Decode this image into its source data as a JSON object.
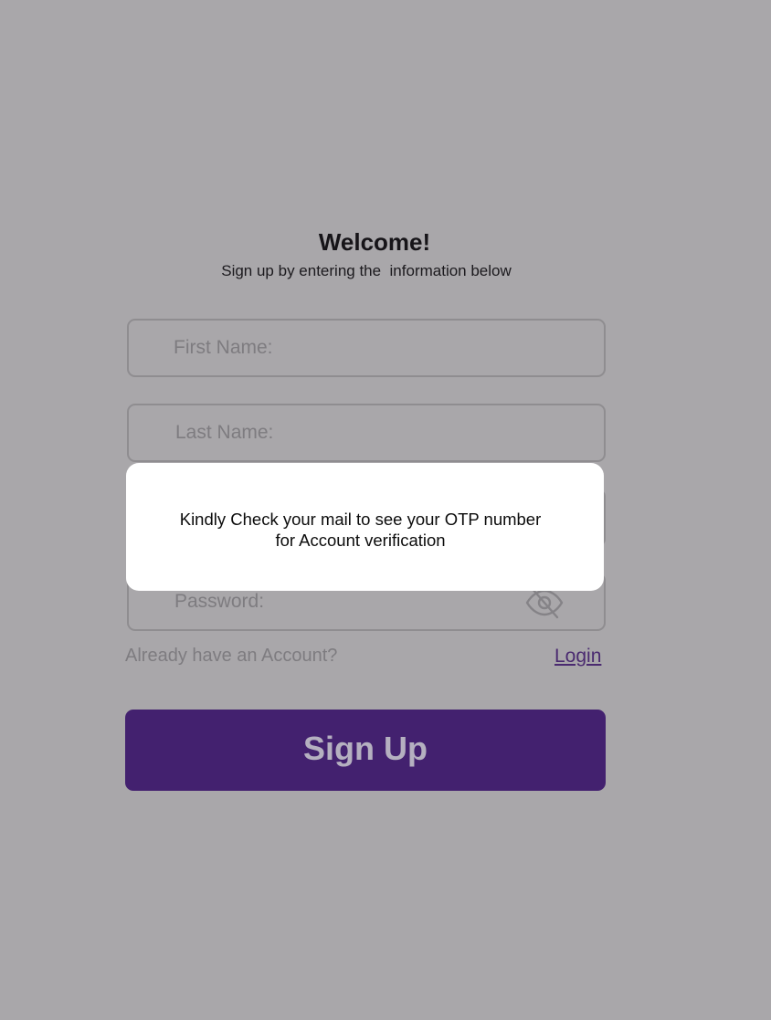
{
  "header": {
    "title": "Welcome!",
    "subtitle": "Sign up by entering the  information below"
  },
  "form": {
    "first_name_placeholder": "First Name:",
    "last_name_placeholder": "Last Name:",
    "email_placeholder": "",
    "password_placeholder": "Password:",
    "password_visibility_icon": "eye-off-icon",
    "account_prompt": "Already have an Account?",
    "login_link": "Login",
    "signup_button": "Sign Up"
  },
  "dialog": {
    "message_line1": "Kindly Check your mail to see your OTP number",
    "message_line2": "for Account verification"
  },
  "colors": {
    "overlay_background": "#a9a7aa",
    "primary_button": "#43216f",
    "link": "#4a2a70",
    "dialog_background": "#ffffff"
  }
}
